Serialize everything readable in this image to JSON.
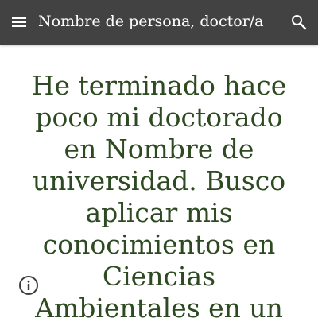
{
  "header": {
    "site_title": "Nombre de persona, doctor/a",
    "menu_icon": "hamburger-menu-icon",
    "search_icon": "search-icon",
    "background_color": "#424242",
    "text_color": "#ffffff"
  },
  "main": {
    "heading": "He terminado hace poco mi doctorado en Nombre de universidad. Busco aplicar mis conocimientos en Ciencias Ambientales en un",
    "heading_color": "#2e4a22"
  },
  "footer": {
    "info_icon": "info-icon"
  }
}
